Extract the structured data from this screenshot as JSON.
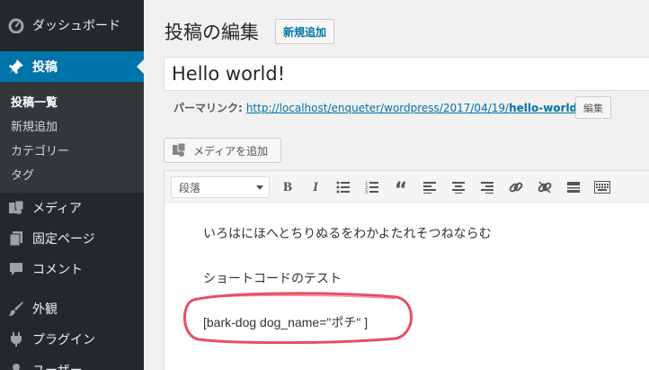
{
  "sidebar": {
    "items": [
      {
        "label": "ダッシュボード",
        "icon": "dashboard-icon"
      },
      {
        "label": "投稿",
        "icon": "pin-icon"
      },
      {
        "label": "メディア",
        "icon": "media-icon"
      },
      {
        "label": "固定ページ",
        "icon": "page-icon"
      },
      {
        "label": "コメント",
        "icon": "comment-icon"
      },
      {
        "label": "外観",
        "icon": "brush-icon"
      },
      {
        "label": "プラグイン",
        "icon": "plugin-icon"
      },
      {
        "label": "ユーザー",
        "icon": "user-icon"
      }
    ],
    "submenu": [
      "投稿一覧",
      "新規追加",
      "カテゴリー",
      "タグ"
    ]
  },
  "header": {
    "title": "投稿の編集",
    "add_new": "新規追加"
  },
  "post": {
    "title": "Hello world!",
    "permalink_label": "パーマリンク:",
    "permalink_base": "http://localhost/enqueter/wordpress/2017/04/19/",
    "permalink_slug": "hello-world",
    "permalink_trail": "/",
    "edit_label": "編集",
    "add_media": "メディアを追加"
  },
  "toolbar": {
    "format": "段落"
  },
  "content": {
    "lines": [
      "いろはにほへとちりぬるをわかよたれそつねならむ",
      "ショートコードのテスト",
      "[bark-dog dog_name=\"ポチ\" ]"
    ]
  },
  "colors": {
    "sidebar_bg": "#23282d",
    "active": "#0073aa",
    "highlight": "#e84e64"
  }
}
